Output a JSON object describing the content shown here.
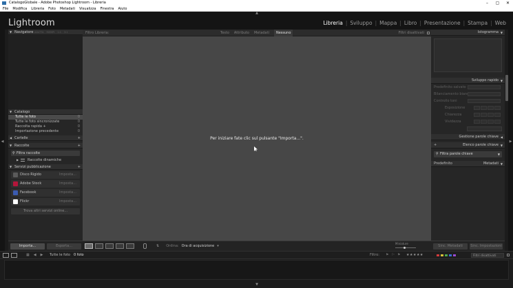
{
  "window": {
    "title": "CatalogoGlobale - Adobe Photoshop Lightroom - Libreria",
    "controls": [
      "–",
      "▢",
      "✕"
    ]
  },
  "menu": [
    "File",
    "Modifica",
    "Libreria",
    "Foto",
    "Metadati",
    "Visualizza",
    "Finestra",
    "Aiuto"
  ],
  "identity": {
    "logo": "Lightroom",
    "modules": [
      "Libreria",
      "Sviluppo",
      "Mappa",
      "Libro",
      "Presentazione",
      "Stampa",
      "Web"
    ],
    "active_module": "Libreria"
  },
  "left_panel": {
    "navigator": {
      "title": "Navigatore",
      "modes": [
        "ADATTA",
        "RIEMPI",
        "1:1",
        "3:1"
      ]
    },
    "catalog": {
      "title": "Catalogo",
      "items": [
        {
          "label": "Tutte le foto",
          "count": "0"
        },
        {
          "label": "Tutte le foto sincronizzate",
          "count": "0"
        },
        {
          "label": "Raccolta rapida +",
          "count": "0"
        },
        {
          "label": "Importazione precedente",
          "count": "0"
        }
      ]
    },
    "folders": {
      "title": "Cartelle"
    },
    "collections": {
      "title": "Raccolte",
      "filter_label": "Filtra raccolte",
      "items": [
        {
          "label": "Raccolte dinamiche"
        }
      ]
    },
    "publish": {
      "title": "Servizi pubblicazione",
      "services": [
        {
          "label": "Disco Rigido",
          "action": "Imposta...",
          "color": "#5a5a5a"
        },
        {
          "label": "Adobe Stock",
          "action": "Imposta...",
          "color": "#b3163b"
        },
        {
          "label": "Facebook",
          "action": "Imposta...",
          "color": "#3b5bb0"
        },
        {
          "label": "Flickr",
          "action": "Imposta...",
          "color": "#ffffff"
        }
      ],
      "find_more": "Trova altri servizi online..."
    },
    "import_button": "Importa...",
    "export_button": "Esporta..."
  },
  "filter_bar": {
    "title": "Filtro Libreria:",
    "tabs": [
      "Testo",
      "Attributo",
      "Metadati",
      "Nessuno"
    ],
    "active_tab": "Nessuno",
    "custom": "Filtri disattivati"
  },
  "center": {
    "message": "Per iniziare fate clic sul pulsante \"Importa...\"."
  },
  "toolbar": {
    "sort_label": "Ordina:",
    "sort_value": "Ora di acquisizione",
    "thumbnails_label": "Miniature"
  },
  "right_panel": {
    "histogram": {
      "title": "Istogramma"
    },
    "quick_develop": {
      "title": "Sviluppo rapido",
      "rows": [
        "Predefinito salvato",
        "Bilanciamento bianco",
        "Controllo toni",
        "Esposizione",
        "Chiarezza",
        "Vividezza"
      ]
    },
    "keywording": {
      "title": "Gestione parole chiave"
    },
    "keyword_list": {
      "title": "Elenco parole chiave",
      "filter_label": "Filtra parole chiave"
    },
    "metadata": {
      "title": "Metadati",
      "preset": "Predefinito"
    },
    "sync_metadata_button": "Sinc. Metadati",
    "sync_settings_button": "Sinc. Impostazioni"
  },
  "filmstrip_bar": {
    "source": "Tutte le foto",
    "count": "0 foto",
    "filter_label": "Filtro:",
    "stars": "★★★★★",
    "label_colors": [
      "#d23b3b",
      "#d6c13a",
      "#4ea84e",
      "#3b6fd2",
      "#9a4ad2"
    ],
    "custom_filter": "Filtri disattivati"
  }
}
